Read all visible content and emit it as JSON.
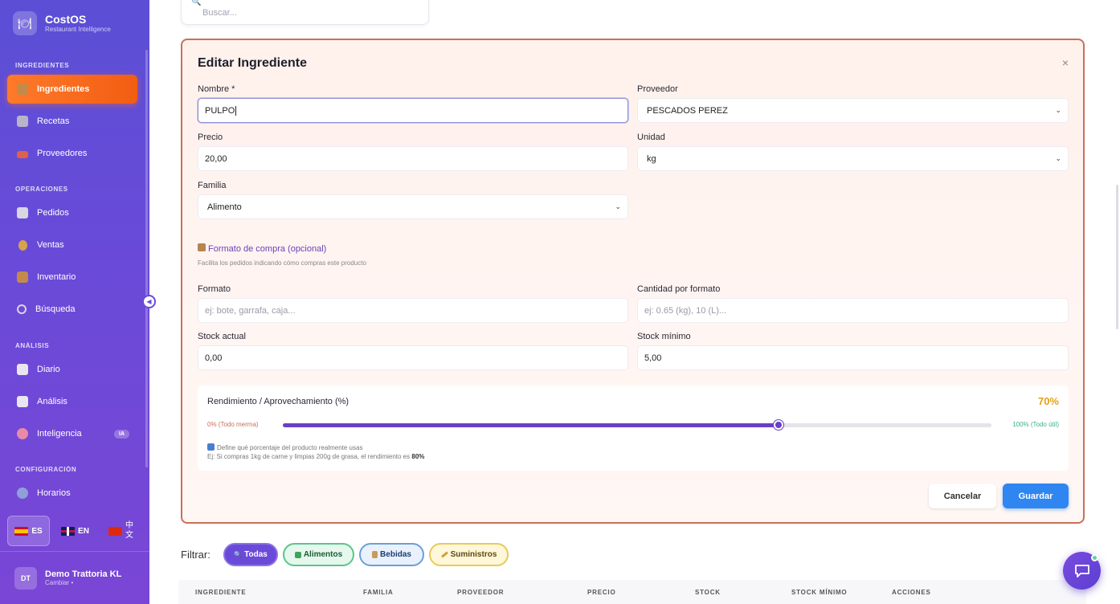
{
  "brand": {
    "name": "CostOS",
    "subtitle": "Restaurant Intelligence"
  },
  "sidebar": {
    "sections": {
      "ingredientes": "INGREDIENTES",
      "operaciones": "OPERACIONES",
      "analisis": "ANÁLISIS",
      "configuracion": "CONFIGURACIÓN"
    },
    "items": [
      {
        "label": "Ingredientes",
        "icon": "box-icon",
        "active": true
      },
      {
        "label": "Recetas",
        "icon": "recipe-icon"
      },
      {
        "label": "Proveedores",
        "icon": "truck-icon"
      },
      {
        "label": "Pedidos",
        "icon": "clipboard-icon"
      },
      {
        "label": "Ventas",
        "icon": "money-bag-icon"
      },
      {
        "label": "Inventario",
        "icon": "package-icon"
      },
      {
        "label": "Búsqueda",
        "icon": "search-icon"
      },
      {
        "label": "Diario",
        "icon": "chart-up-icon"
      },
      {
        "label": "Análisis",
        "icon": "bar-chart-icon"
      },
      {
        "label": "Inteligencia",
        "icon": "brain-icon",
        "badge": "IA"
      },
      {
        "label": "Horarios",
        "icon": "people-icon"
      }
    ],
    "languages": [
      {
        "code": "ES",
        "flag": "spain-flag-icon",
        "active": true
      },
      {
        "code": "EN",
        "flag": "uk-flag-icon"
      },
      {
        "code": "中文",
        "flag": "china-flag-icon"
      }
    ],
    "user": {
      "initials": "DT",
      "name": "Demo Trattoria KL",
      "action": "Cambiar •"
    }
  },
  "search": {
    "placeholder": "Buscar..."
  },
  "modal": {
    "title": "Editar Ingrediente",
    "close": "×",
    "fields": {
      "nombre": {
        "label": "Nombre *",
        "value": "PULPO"
      },
      "proveedor": {
        "label": "Proveedor",
        "value": "PESCADOS PEREZ"
      },
      "precio": {
        "label": "Precio",
        "value": "20,00"
      },
      "unidad": {
        "label": "Unidad",
        "value": "kg"
      },
      "familia": {
        "label": "Familia",
        "value": "Alimento"
      },
      "formato": {
        "label": "Formato",
        "placeholder": "ej: bote, garrafa, caja..."
      },
      "cantidad": {
        "label": "Cantidad por formato",
        "placeholder": "ej: 0.65 (kg), 10 (L)..."
      },
      "stock_actual": {
        "label": "Stock actual",
        "value": "0,00"
      },
      "stock_minimo": {
        "label": "Stock mínimo",
        "value": "5,00"
      }
    },
    "purchase_format": {
      "title": "Formato de compra (opcional)",
      "subtitle": "Facilita los pedidos indicando cómo compras este producto"
    },
    "yield": {
      "title": "Rendimiento / Aprovechamiento (%)",
      "value_label": "70%",
      "value": 0.7,
      "min_label": "0% (Todo merma)",
      "max_label": "100% (Todo útil)",
      "hint": "Define qué porcentaje del producto realmente usas",
      "example_prefix": "Ej: Si compras 1kg de carne y limpias 200g de grasa, el rendimiento es",
      "example_value": "80%"
    },
    "buttons": {
      "cancel": "Cancelar",
      "save": "Guardar"
    }
  },
  "filters": {
    "label": "Filtrar:",
    "chips": [
      "Todas",
      "Alimentos",
      "Bebidas",
      "Suministros"
    ]
  },
  "table": {
    "headers": [
      "INGREDIENTE",
      "FAMILIA",
      "PROVEEDOR",
      "PRECIO",
      "STOCK",
      "STOCK MÍNIMO",
      "ACCIONES"
    ]
  },
  "colors": {
    "accent": "#6a4ad8",
    "active_nav": "#f25d12",
    "save": "#2f86f0",
    "yield_value": "#e0a21a"
  }
}
